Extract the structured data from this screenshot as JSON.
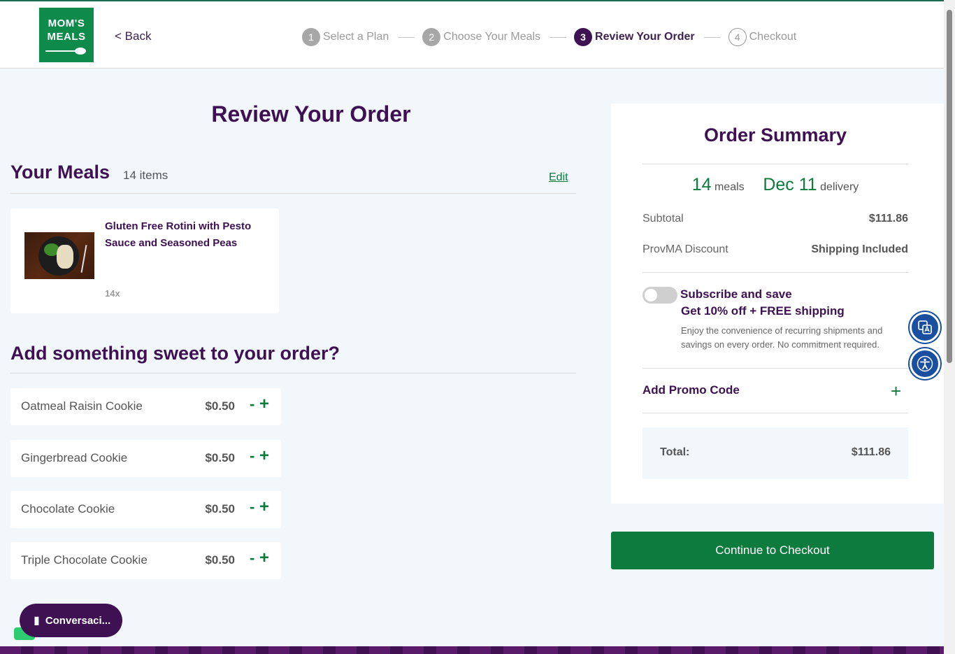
{
  "header": {
    "logo_line1": "MOM'S",
    "logo_line2": "MEALS",
    "back_label": "< Back",
    "steps": [
      {
        "num": "1",
        "label": "Select a Plan"
      },
      {
        "num": "2",
        "label": "Choose Your Meals"
      },
      {
        "num": "3",
        "label": "Review Your Order"
      },
      {
        "num": "4",
        "label": "Checkout"
      }
    ]
  },
  "main": {
    "title": "Review Your Order",
    "meals_title": "Your Meals",
    "meals_count": "14 items",
    "edit_label": "Edit",
    "meal": {
      "name": "Gluten Free Rotini with Pesto Sauce and Seasoned Peas",
      "qty": "14x"
    },
    "sweet_title": "Add something sweet to your order?",
    "addons": [
      {
        "name": "Oatmeal Raisin Cookie",
        "price": "$0.50"
      },
      {
        "name": "Gingerbread Cookie",
        "price": "$0.50"
      },
      {
        "name": "Chocolate Cookie",
        "price": "$0.50"
      },
      {
        "name": "Triple Chocolate Cookie",
        "price": "$0.50"
      }
    ],
    "minus": "-",
    "plus": "+"
  },
  "summary": {
    "title": "Order Summary",
    "meals_num": "14",
    "meals_word": "meals",
    "delivery_date": "Dec 11",
    "delivery_word": "delivery",
    "subtotal_label": "Subtotal",
    "subtotal_value": "$111.86",
    "discount_label": "ProvMA Discount",
    "discount_value": "Shipping Included",
    "subscribe_title": "Subscribe and save",
    "subscribe_offer": "Get 10% off + FREE shipping",
    "subscribe_desc": "Enjoy the convenience of recurring shipments and savings on every order. No commitment required.",
    "subscribe_on": false,
    "promo_label": "Add Promo Code",
    "promo_plus": "+",
    "total_label": "Total:",
    "total_value": "$111.86",
    "checkout_label": "Continue to Checkout"
  },
  "widgets": {
    "chat_label": "Conversaci...",
    "translate_icon": "translate-icon",
    "accessibility_icon": "accessibility-icon"
  },
  "colors": {
    "brand_green": "#0e8a4a",
    "brand_purple": "#3d1152",
    "background": "#f2f7fb"
  }
}
